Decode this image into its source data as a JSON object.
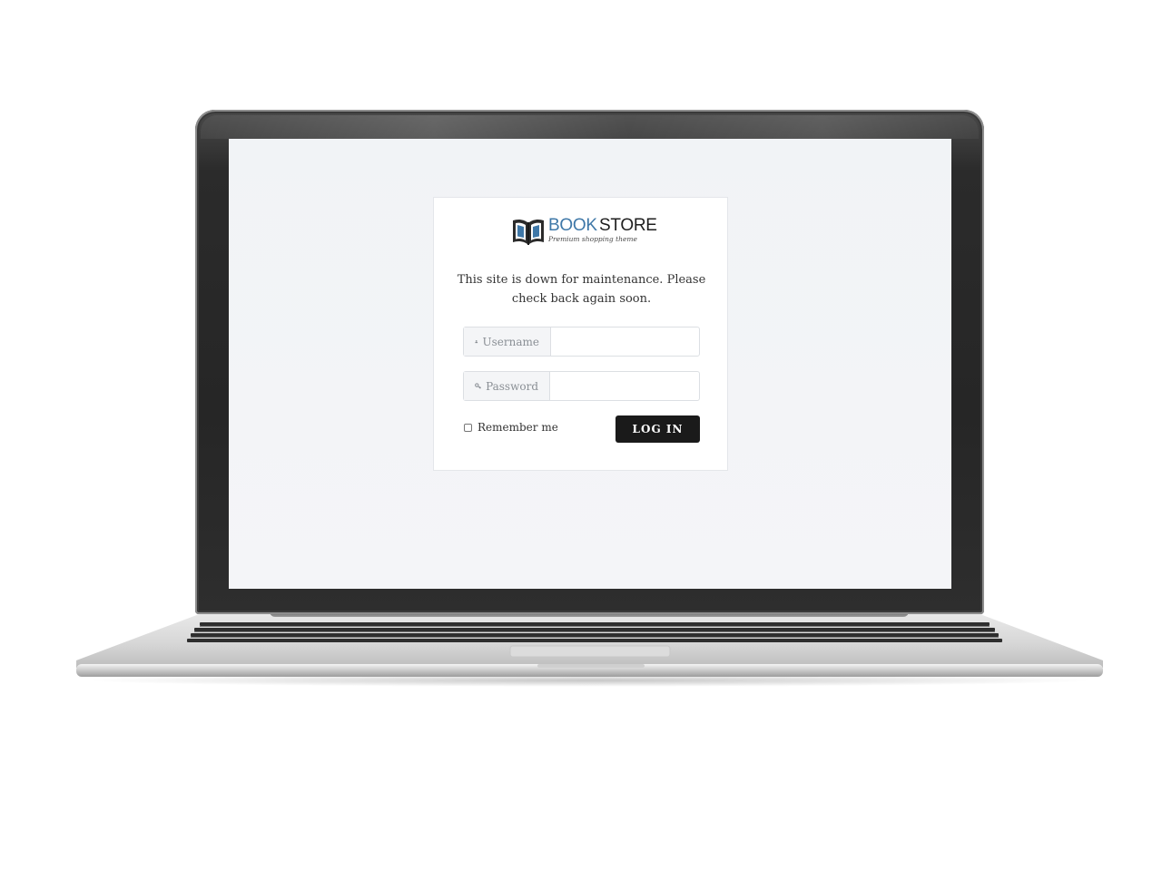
{
  "brand": {
    "name_part1": "BOOK",
    "name_part2": "STORE",
    "tagline": "Premium shopping theme",
    "logo_icon": "open-book-icon",
    "accent_color": "#3f78a8"
  },
  "maintenance": {
    "message": "This site is down for maintenance. Please check back again soon."
  },
  "login_form": {
    "username": {
      "label": "Username",
      "icon": "user-icon",
      "value": ""
    },
    "password": {
      "label": "Password",
      "icon": "key-icon",
      "value": ""
    },
    "remember_me": {
      "label": "Remember me",
      "checked": false
    },
    "submit_label": "LOG IN",
    "submit_color": "#1a1a1a"
  }
}
